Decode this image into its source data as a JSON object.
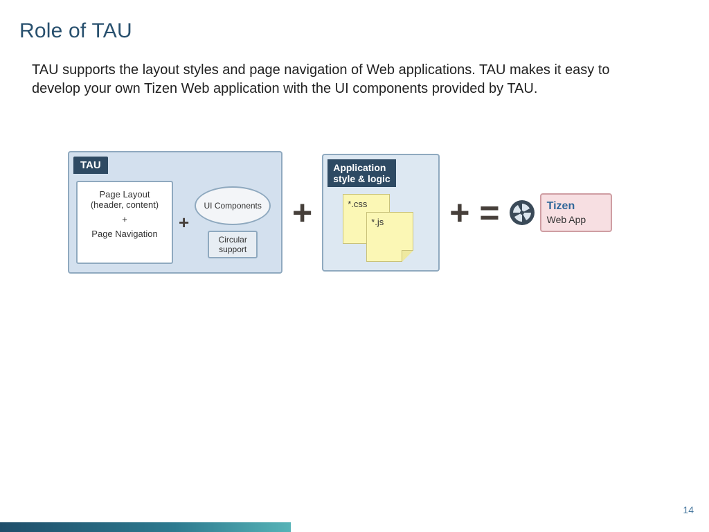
{
  "title": "Role of TAU",
  "paragraph": "TAU supports the layout styles and page navigation of Web applications. TAU makes it easy to develop your own Tizen Web application with the UI components provided by TAU.",
  "diagram": {
    "tau": {
      "label": "TAU",
      "page_layout_line1": "Page Layout",
      "page_layout_line2": "(header, content)",
      "plus": "+",
      "page_navigation": "Page Navigation",
      "ui_components": "UI Components",
      "circular_support": "Circular support"
    },
    "op_plus": "+",
    "app": {
      "label_line1": "Application",
      "label_line2": "style & logic",
      "note_css": "*.css",
      "note_js": "*.js"
    },
    "op_equals": "=",
    "result": {
      "brand": "Tizen",
      "sub": "Web App"
    }
  },
  "page_number": "14"
}
